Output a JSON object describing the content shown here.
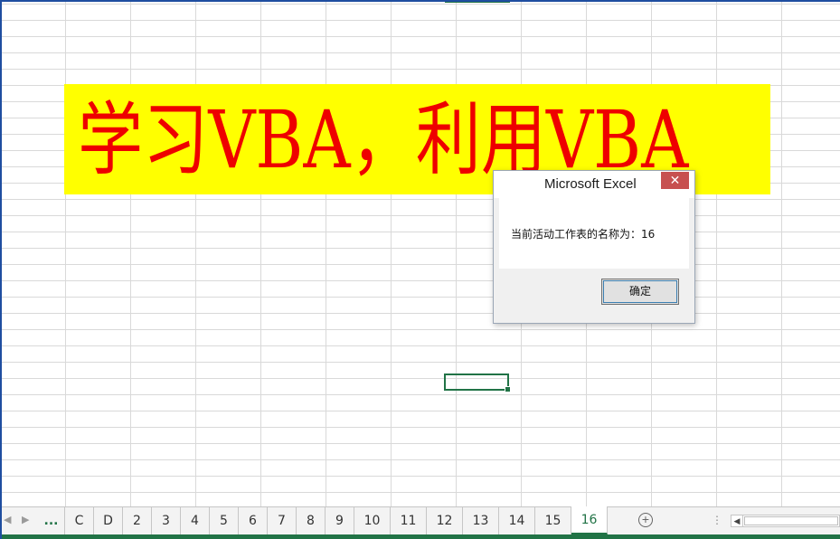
{
  "banner": {
    "text": "学习VBA，利用VBA"
  },
  "dialog": {
    "title": "Microsoft Excel",
    "close_glyph": "✕",
    "message": "当前活动工作表的名称为：16",
    "ok_label": "确定"
  },
  "sheet_tabs": {
    "ellipsis": "...",
    "items": [
      "C",
      "D",
      "2",
      "3",
      "4",
      "5",
      "6",
      "7",
      "8",
      "9",
      "10",
      "11",
      "12",
      "13",
      "14",
      "15",
      "16"
    ],
    "active": "16"
  },
  "icons": {
    "nav_left": "◀",
    "nav_right": "▶",
    "add_sheet": "+",
    "options": "⋮",
    "scroll_left": "◀"
  },
  "colors": {
    "banner_bg": "#ffff00",
    "banner_text": "#ee0000",
    "accent": "#217346",
    "close_button": "#c75050"
  }
}
